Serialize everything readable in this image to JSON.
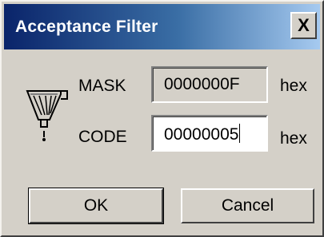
{
  "window": {
    "title": "Acceptance Filter",
    "close_glyph": "X",
    "icon": "funnel-filter-icon"
  },
  "fields": {
    "mask": {
      "label": "MASK",
      "value": "0000000F",
      "unit": "hex"
    },
    "code": {
      "label": "CODE",
      "value": "00000005",
      "unit": "hex"
    }
  },
  "buttons": {
    "ok_label": "OK",
    "cancel_label": "Cancel"
  },
  "colors": {
    "face": "#d4d0c8",
    "title_start": "#0a246a",
    "title_end": "#a6caf0"
  }
}
